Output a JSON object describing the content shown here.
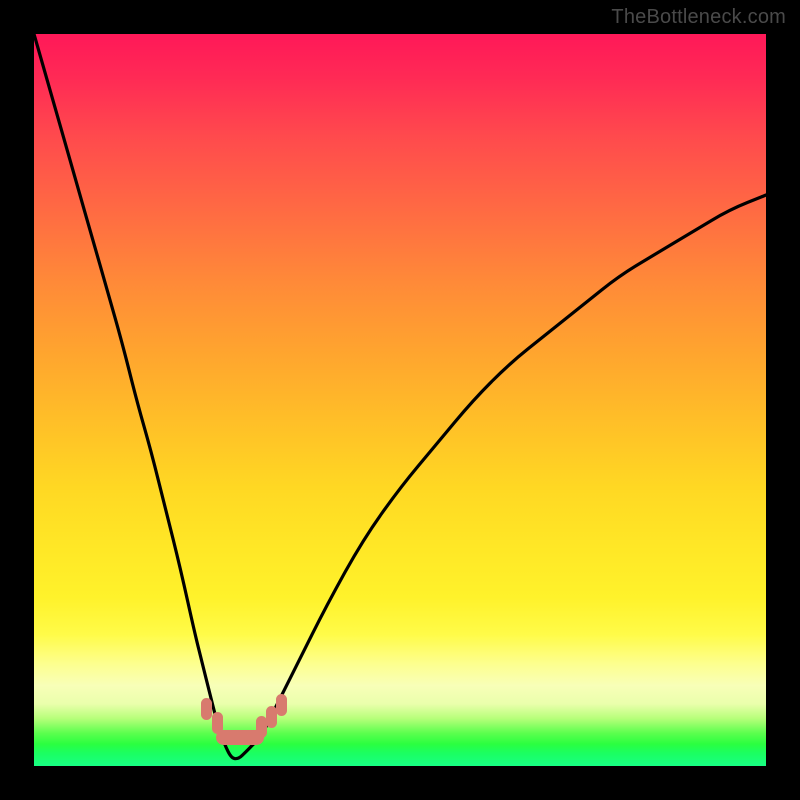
{
  "watermark": "TheBottleneck.com",
  "colors": {
    "frame": "#000000",
    "curve": "#000000",
    "tick": "#d87a6e"
  },
  "chart_data": {
    "type": "line",
    "title": "",
    "xlabel": "",
    "ylabel": "",
    "xlim": [
      0,
      100
    ],
    "ylim": [
      0,
      100
    ],
    "grid": false,
    "legend": false,
    "notes": "Bottleneck-style V-curve. Background is a vertical gradient where low y-values (near bottom) map to green/yellow and high y-values map to red. Curve minimum (≈0) occurs near x≈27; pink tick markers cluster along the valley floor from roughly x≈24 to x≈33.",
    "series": [
      {
        "name": "bottleneck-curve",
        "x": [
          0,
          2,
          4,
          6,
          8,
          10,
          12,
          14,
          16,
          18,
          20,
          22,
          23,
          24,
          25,
          26,
          27,
          28,
          29,
          30,
          31,
          32,
          34,
          36,
          40,
          45,
          50,
          55,
          60,
          65,
          70,
          75,
          80,
          85,
          90,
          95,
          100
        ],
        "y": [
          100,
          93,
          86,
          79,
          72,
          65,
          58,
          50,
          43,
          35,
          27,
          18,
          14,
          10,
          6,
          3,
          1,
          1,
          2,
          3,
          4,
          6,
          10,
          14,
          22,
          31,
          38,
          44,
          50,
          55,
          59,
          63,
          67,
          70,
          73,
          76,
          78
        ]
      }
    ],
    "markers": {
      "name": "valley-ticks",
      "x": [
        24,
        25.5,
        30.5,
        32,
        33.5
      ],
      "y": [
        4,
        3,
        2,
        3,
        4
      ]
    }
  }
}
